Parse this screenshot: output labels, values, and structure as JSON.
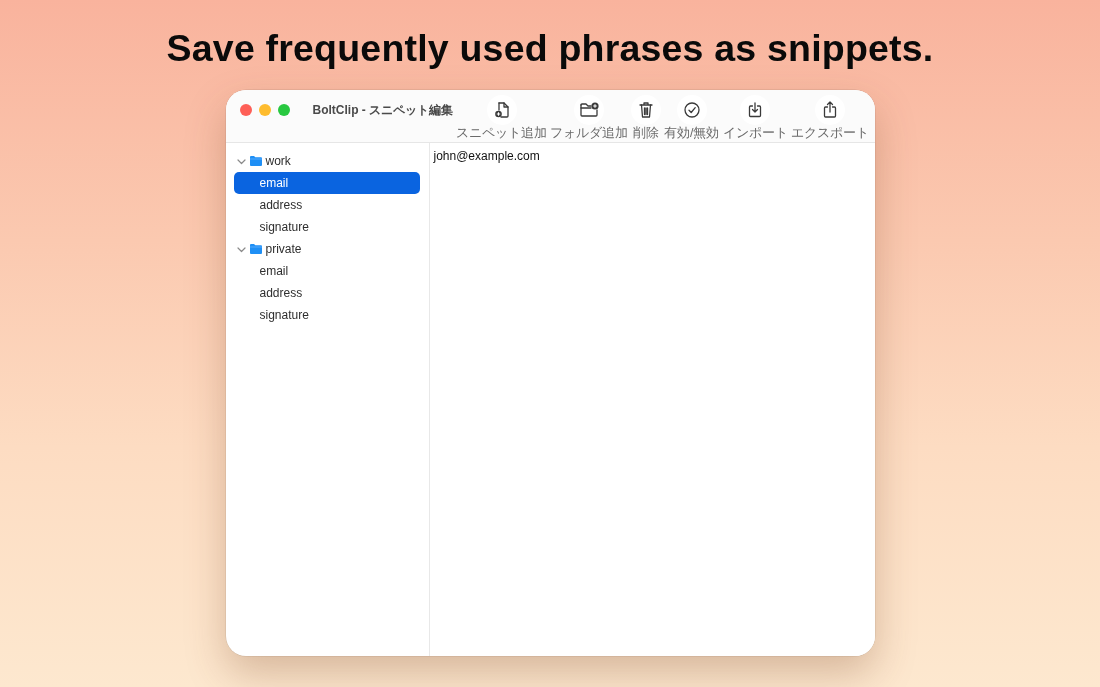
{
  "headline": "Save frequently used phrases as snippets.",
  "window": {
    "title": "BoltClip - スニペット編集"
  },
  "toolbar": [
    {
      "kind": "add-snippet",
      "label": "スニペット追加"
    },
    {
      "kind": "add-folder",
      "label": "フォルダ追加"
    },
    {
      "kind": "delete",
      "label": "削除"
    },
    {
      "kind": "toggle",
      "label": "有効/無効"
    },
    {
      "kind": "import",
      "label": "インポート"
    },
    {
      "kind": "export",
      "label": "エクスポート"
    }
  ],
  "sidebar": {
    "tree": [
      {
        "label": "work",
        "expanded": true,
        "selected": false,
        "children": [
          {
            "label": "email",
            "selected": true
          },
          {
            "label": "address",
            "selected": false
          },
          {
            "label": "signature",
            "selected": false
          }
        ]
      },
      {
        "label": "private",
        "expanded": true,
        "selected": false,
        "children": [
          {
            "label": "email",
            "selected": false
          },
          {
            "label": "address",
            "selected": false
          },
          {
            "label": "signature",
            "selected": false
          }
        ]
      }
    ]
  },
  "editor": {
    "value": "john@example.com"
  }
}
